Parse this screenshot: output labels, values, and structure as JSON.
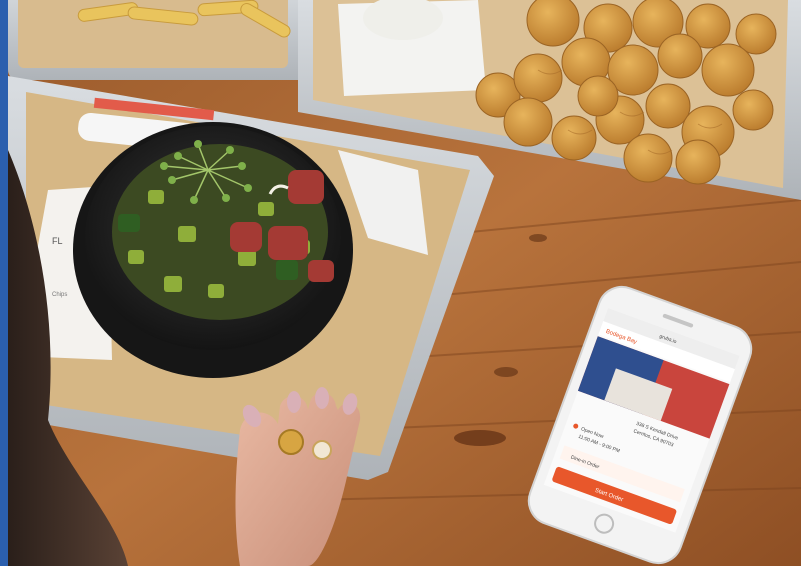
{
  "photo": {
    "description_colors": {
      "accent_bar": "#2b5fae",
      "wood": "#b06a35",
      "tray": "#c9cdd2",
      "paper": "#d7b98c",
      "bowl": "#1f1f1f",
      "phone_accent": "#e8572b"
    }
  },
  "phone_screen": {
    "header_title": "Bodega Bay",
    "url_text": "grubs.io",
    "address_line": "338 S Kendall Drive",
    "address_sub": "Cerritos, CA 90703",
    "open_status": "Open Now",
    "hours": "11:00 AM - 9:00 PM",
    "order_row_label": "Dine-in Order",
    "cta_label": "Start Order"
  },
  "menu_card": {
    "text_top": "FL",
    "text_bottom": "Chips"
  }
}
